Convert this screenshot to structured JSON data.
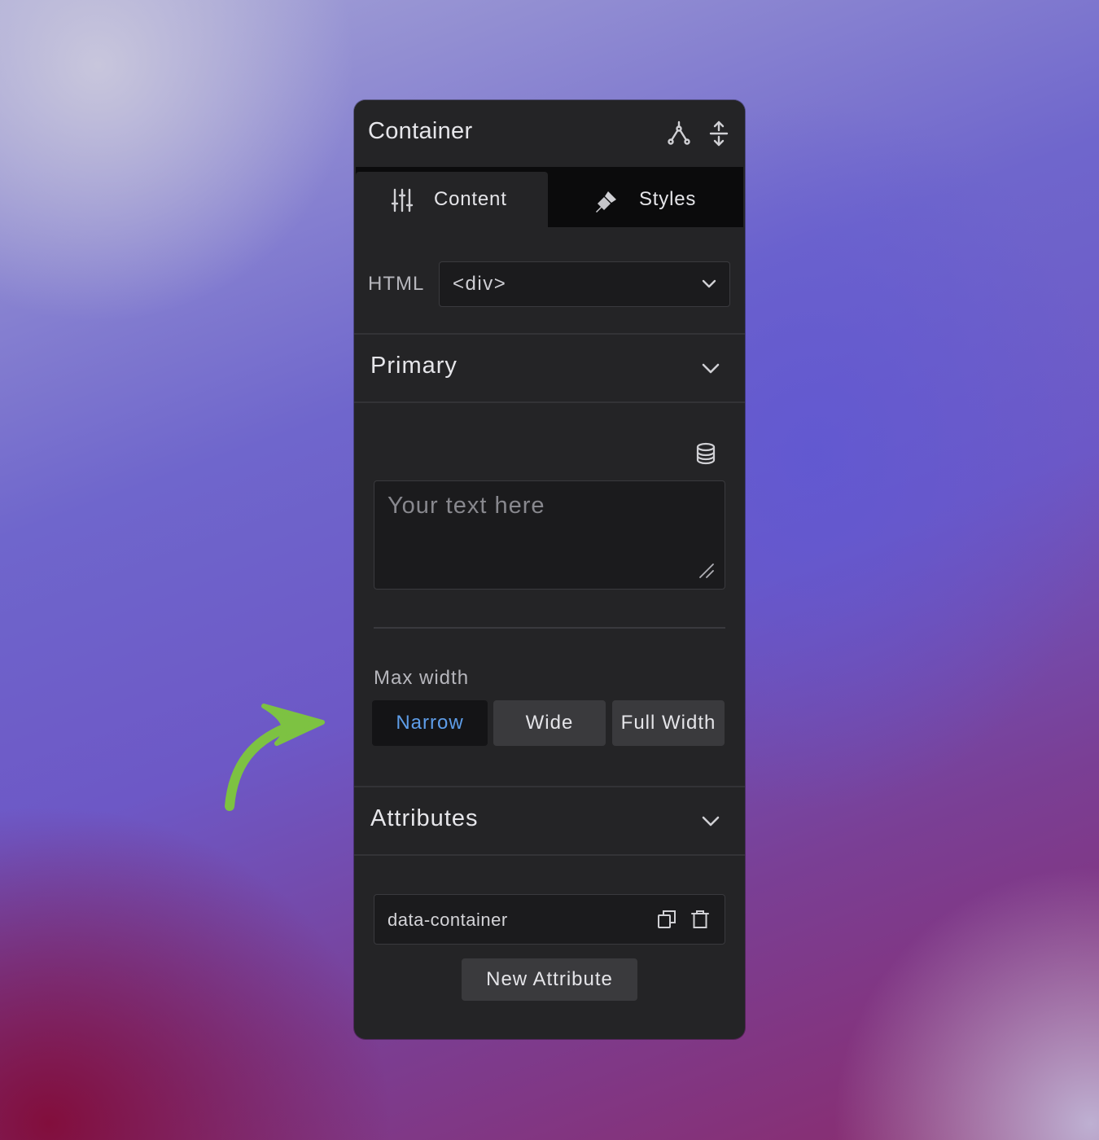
{
  "panel": {
    "title": "Container",
    "header_icons": [
      "branch-icon",
      "vertical-resize-icon"
    ]
  },
  "tabs": [
    {
      "label": "Content",
      "icon": "sliders-icon",
      "active": true
    },
    {
      "label": "Styles",
      "icon": "paintbrush-icon",
      "active": false
    }
  ],
  "html_field": {
    "label": "HTML",
    "value": "<div>"
  },
  "primary": {
    "title": "Primary",
    "text_placeholder": "Your text here",
    "max_width": {
      "label": "Max width",
      "options": [
        "Narrow",
        "Wide",
        "Full Width"
      ],
      "selected": "Narrow"
    }
  },
  "attributes": {
    "title": "Attributes",
    "items": [
      {
        "name": "data-container"
      }
    ],
    "new_button": "New Attribute"
  },
  "colors": {
    "panel_bg": "#242426",
    "accent": "#5e9de8",
    "annotation_arrow": "#7dc242"
  }
}
